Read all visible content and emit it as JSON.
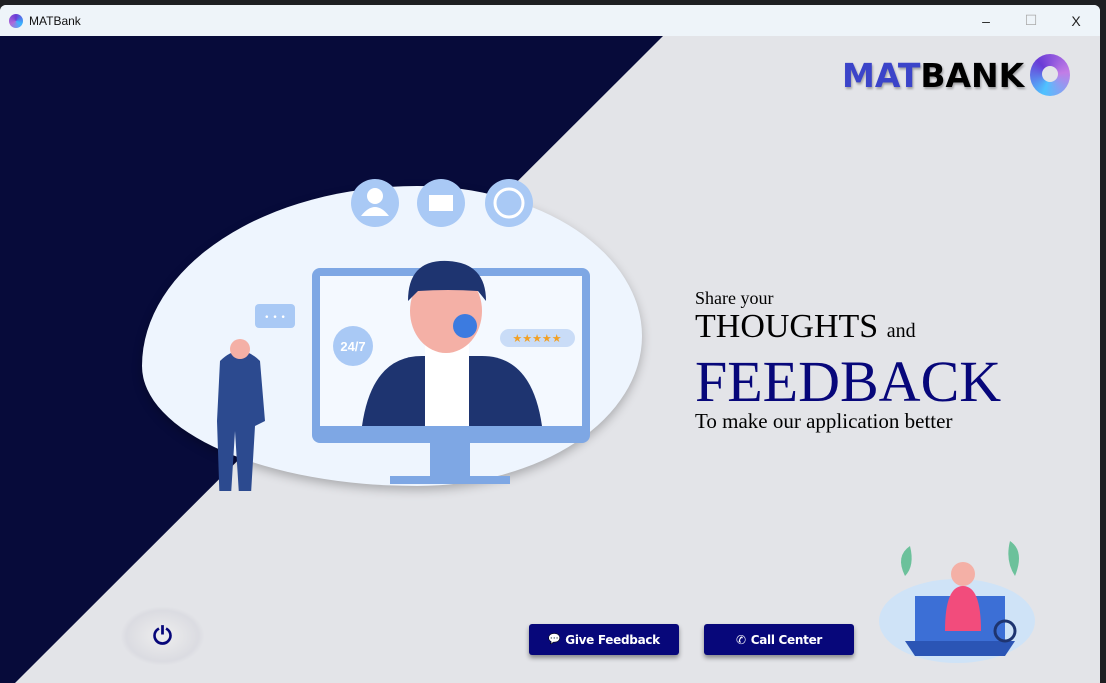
{
  "window": {
    "title": "MATBank",
    "minimize": "–",
    "maximize": "☐",
    "close": "X"
  },
  "logo": {
    "part1": "MAT",
    "part2": "BANK"
  },
  "hero": {
    "line1": "Share your",
    "line2a": "THOUGHTS",
    "line2b": "and",
    "line3": "FEEDBACK",
    "line4": "To make our application  better"
  },
  "illustration": {
    "badge": "24/7",
    "rating": "★★★★★",
    "bubble": "• • •"
  },
  "buttons": {
    "feedback": "Give Feedback",
    "call": "Call Center",
    "feedback_icon": "💬",
    "call_icon": "✆"
  },
  "power_icon": "⏻"
}
